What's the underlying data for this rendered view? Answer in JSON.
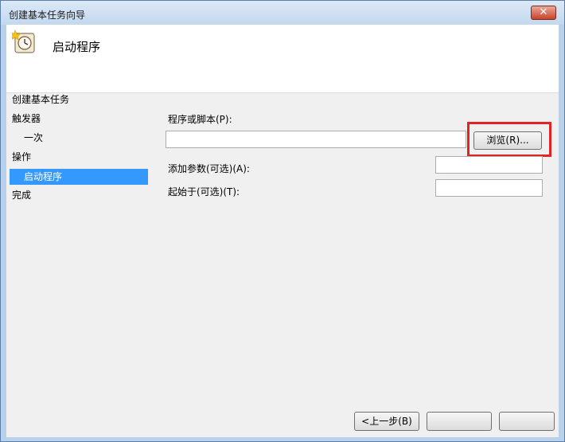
{
  "window": {
    "title": "创建基本任务向导",
    "close_symbol": "✕"
  },
  "header": {
    "title": "启动程序",
    "icon": "clock-wizard-icon"
  },
  "nav": {
    "section_title": "创建基本任务",
    "items": [
      {
        "label": "触发器"
      },
      {
        "label": "一次"
      },
      {
        "label": "操作"
      },
      {
        "label": "启动程序"
      },
      {
        "label": "完成"
      }
    ]
  },
  "form": {
    "program_label": "程序或脚本(P):",
    "program_value": "",
    "browse_label": "浏览(R)...",
    "args_label": "添加参数(可选)(A):",
    "args_value": "",
    "start_in_label": "起始于(可选)(T):",
    "start_in_value": ""
  },
  "footer": {
    "back_label": "<上一步(B)"
  },
  "colors": {
    "selection": "#3399ff",
    "highlight_box": "#e02424"
  }
}
